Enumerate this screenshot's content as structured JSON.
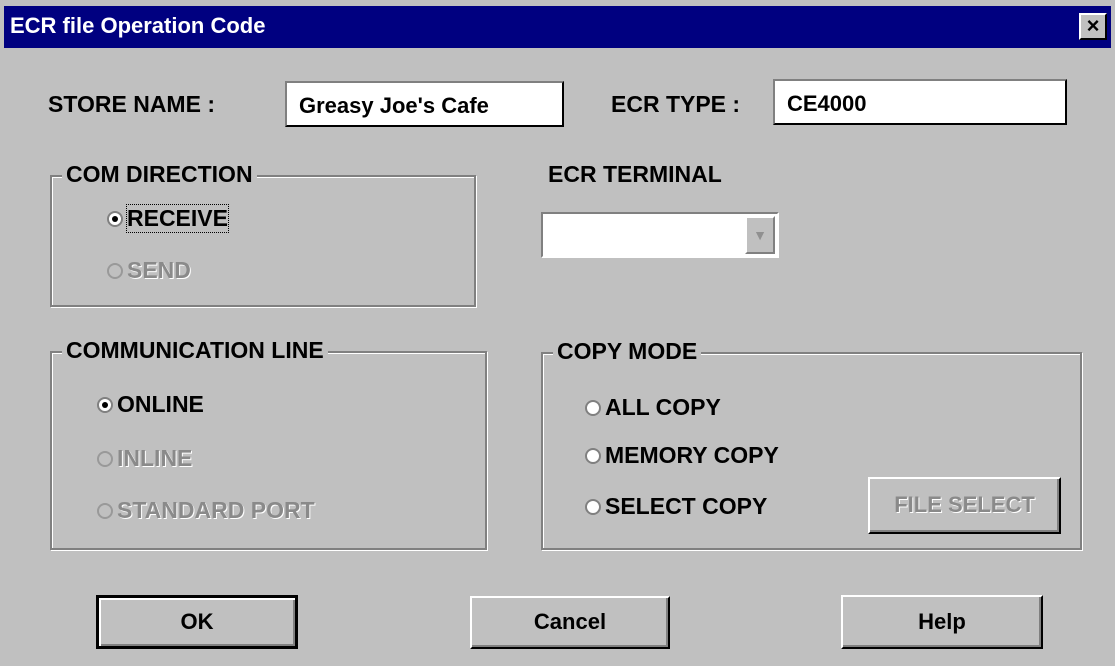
{
  "window": {
    "title": "ECR file Operation Code",
    "close_glyph": "×"
  },
  "store": {
    "label": "STORE NAME :",
    "value": "Greasy Joe's Cafe"
  },
  "ecr_type": {
    "label": "ECR TYPE :",
    "value": "CE4000"
  },
  "com_direction": {
    "legend": "COM DIRECTION",
    "options": [
      {
        "label": "RECEIVE",
        "checked": true,
        "enabled": true
      },
      {
        "label": "SEND",
        "checked": false,
        "enabled": false
      }
    ]
  },
  "ecr_terminal": {
    "label": "ECR TERMINAL",
    "selected": "",
    "arrow_glyph": "▼"
  },
  "communication_line": {
    "legend": "COMMUNICATION LINE",
    "options": [
      {
        "label": "ONLINE",
        "checked": true,
        "enabled": true
      },
      {
        "label": "INLINE",
        "checked": false,
        "enabled": false
      },
      {
        "label": "STANDARD PORT",
        "checked": false,
        "enabled": false
      }
    ]
  },
  "copy_mode": {
    "legend": "COPY MODE",
    "options": [
      {
        "label": "ALL COPY",
        "checked": false,
        "enabled": true
      },
      {
        "label": "MEMORY COPY",
        "checked": false,
        "enabled": true
      },
      {
        "label": "SELECT COPY",
        "checked": false,
        "enabled": true
      }
    ],
    "file_select_label": "FILE SELECT"
  },
  "buttons": {
    "ok": "OK",
    "cancel": "Cancel",
    "help": "Help"
  }
}
